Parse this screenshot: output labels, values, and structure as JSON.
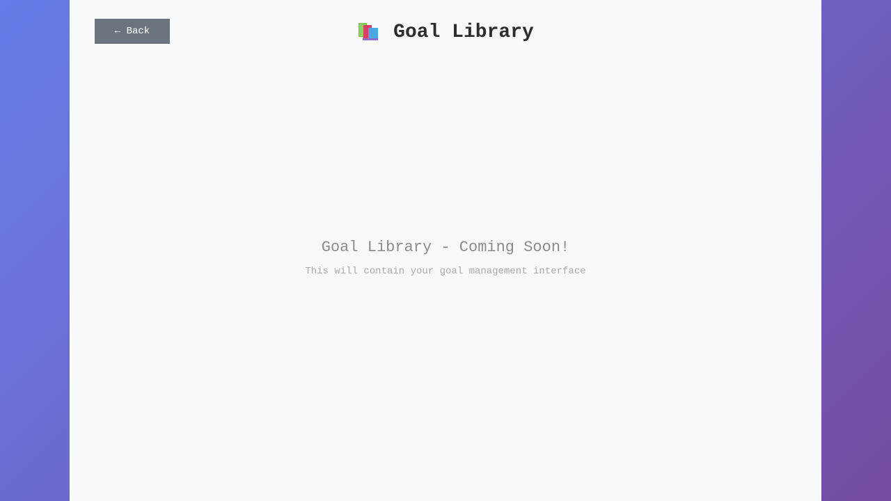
{
  "header": {
    "back_label": "← Back",
    "title": "Goal Library",
    "icon": "books-icon"
  },
  "main": {
    "heading": "Goal Library - Coming Soon!",
    "description": "This will contain your goal management interface"
  },
  "colors": {
    "background_gradient_start": "#667eea",
    "background_gradient_end": "#764ba2",
    "panel": "#f7f9fb",
    "back_button": "#6c757d"
  }
}
